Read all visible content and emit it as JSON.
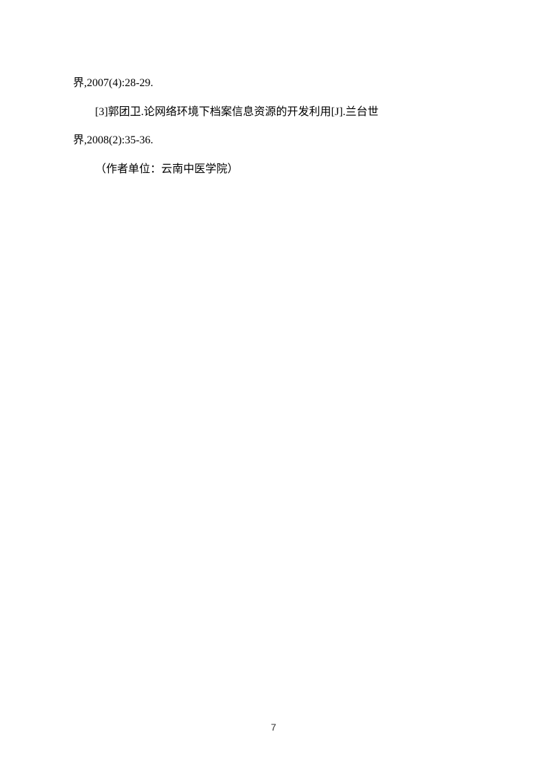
{
  "body": {
    "line1": "界,2007(4):28-29.",
    "line2": "[3]郭团卫.论网络环境下档案信息资源的开发利用[J].兰台世",
    "line3": "界,2008(2):35-36.",
    "line4": "（作者单位：云南中医学院）"
  },
  "pageNumber": "7"
}
